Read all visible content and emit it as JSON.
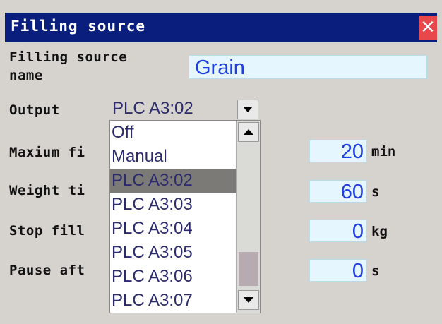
{
  "window": {
    "title": "Filling source"
  },
  "form": {
    "name_label_line1": "Filling source",
    "name_label_line2": "name",
    "name_value": "Grain",
    "output_label": "Output",
    "output_value": "PLC A3:02",
    "max_label": "Maxium fi",
    "max_value": "20",
    "max_unit": "min",
    "weight_label": "Weight ti",
    "weight_value": "60",
    "weight_unit": "s",
    "stop_label": "Stop fill",
    "stop_value": "0",
    "stop_unit": "kg",
    "pause_label": "Pause aft",
    "pause_value": "0",
    "pause_unit": "s"
  },
  "dropdown": {
    "options": [
      "Off",
      "Manual",
      "PLC A3:02",
      "PLC A3:03",
      "PLC A3:04",
      "PLC A3:05",
      "PLC A3:06",
      "PLC A3:07"
    ],
    "selected": "PLC A3:02"
  },
  "icons": {
    "close": "close-icon",
    "scroll_up": "arrow-up-icon",
    "scroll_down": "arrow-down-icon",
    "select_arrow": "chevron-down-icon"
  },
  "colors": {
    "titlebar": "#0a1f7d",
    "close": "#e8474c",
    "field_bg": "#e6f6ff",
    "field_text": "#1f3fe0",
    "background": "#d6d3ce"
  }
}
